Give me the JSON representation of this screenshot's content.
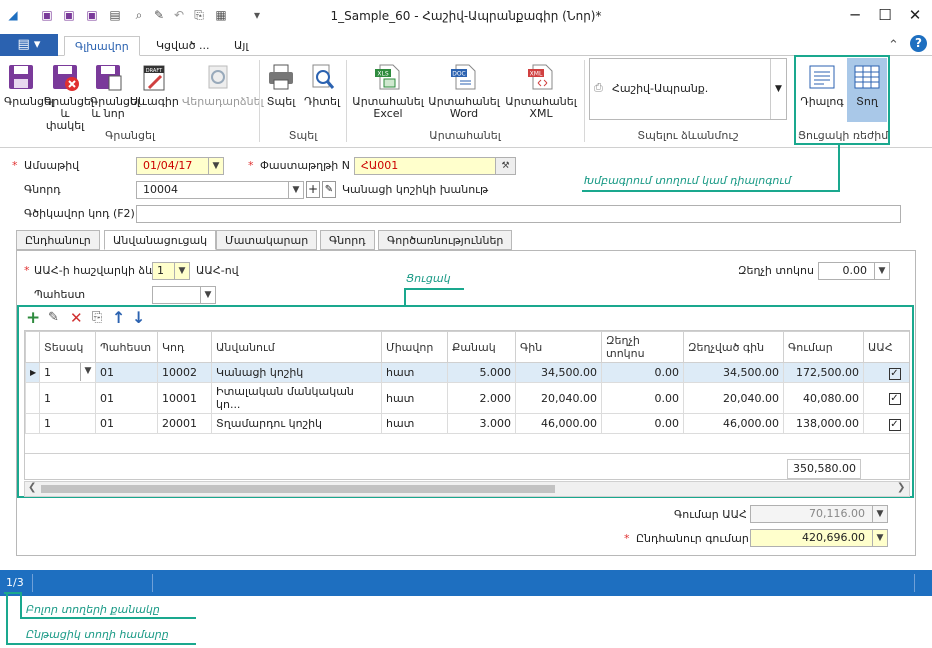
{
  "window": {
    "title": "1_Sample_60 - Հաշիվ-Ապրանքագիր (Նոր)*"
  },
  "ribbon": {
    "file_tab": "▤ ▾",
    "tabs": [
      "Գլխավոր",
      "Կցված ...",
      "Այլ"
    ],
    "buttons": {
      "save": "Գրանցել",
      "save_close": "Գրանցել և փակել",
      "save_new": "Գրանցել և նոր",
      "draft": "Սևագիր",
      "restore": "Վերադարձնել",
      "print": "Տպել",
      "view": "Դիտել",
      "export_excel": "Արտահանել Excel",
      "export_word": "Արտահանել Word",
      "export_xml": "Արտահանել XML",
      "dialog": "Դիալոգ",
      "row": "Տող"
    },
    "groups": {
      "save": "Գրանցել",
      "print": "Տպել",
      "export": "Արտահանել",
      "print_forms": "Տպելու ձևանմուշ",
      "list_mode": "Ցուցակի ռեժիմ"
    },
    "print_form_value": "Հաշիվ-Ապրանք.",
    "draft_badge": "DRAFT",
    "file_badges": {
      "excel": "XLS",
      "word": "DOC",
      "xml": "XML"
    }
  },
  "form": {
    "date_label": "Ամսաթիվ",
    "date_value": "01/04/17",
    "docnum_label": "Փաստաթղթի N",
    "docnum_value": "ՀԱ001",
    "partner_label": "Գնորդ",
    "partner_value": "10004",
    "partner_name": "Կանացի կոշիկի խանութ",
    "barcode_label": "Գծիկավոր կոդ (F2)",
    "barcode_value": ""
  },
  "form_tabs": [
    "Ընդհանուր",
    "Անվանացուցակ",
    "Մատակարար",
    "Գնորդ",
    "Գործառնություններ"
  ],
  "nomen": {
    "vat_label": "ԱԱՀ-ի հաշվարկի ձև",
    "vat_value": "1",
    "vat_text": "ԱԱՀ-ով",
    "store_label": "Պահեստ",
    "store_value": "",
    "discount_label": "Զեղչի տոկոս",
    "discount_value": "0.00"
  },
  "grid": {
    "columns": [
      "Տեսակ",
      "Պահեստ",
      "Կոդ",
      "Անվանում",
      "Միավոր",
      "Քանակ",
      "Գին",
      "Զեղչի տոկոս",
      "Զեղչված գին",
      "Գումար",
      "ԱԱՀ"
    ],
    "rows": [
      [
        "1",
        "01",
        "10002",
        "Կանացի կոշիկ",
        "հատ",
        "5.000",
        "34,500.00",
        "0.00",
        "34,500.00",
        "172,500.00",
        "✓"
      ],
      [
        "1",
        "01",
        "10001",
        "Իտալական մանկական կո...",
        "հատ",
        "2.000",
        "20,040.00",
        "0.00",
        "20,040.00",
        "40,080.00",
        "✓"
      ],
      [
        "1",
        "01",
        "20001",
        "Տղամարդու կոշիկ",
        "հատ",
        "3.000",
        "46,000.00",
        "0.00",
        "46,000.00",
        "138,000.00",
        "✓"
      ]
    ],
    "total": "350,580.00",
    "toolbar_icons": [
      "add-icon",
      "edit-icon",
      "delete-icon",
      "copy-icon",
      "arrow-up-icon",
      "arrow-down-icon"
    ]
  },
  "totals": {
    "vat_label": "Գումար ԱԱՀ",
    "vat_value": "70,116.00",
    "total_label": "Ընդհանուր գումար",
    "total_value": "420,696.00"
  },
  "status": {
    "record": "1/3"
  },
  "annotations": {
    "list_mode": "Խմբագրում տողում կամ դիալոգում",
    "grid": "Ցուցակ",
    "count": "Բոլոր տողերի քանակը",
    "current": "Ընթացիկ տողի համարը"
  }
}
